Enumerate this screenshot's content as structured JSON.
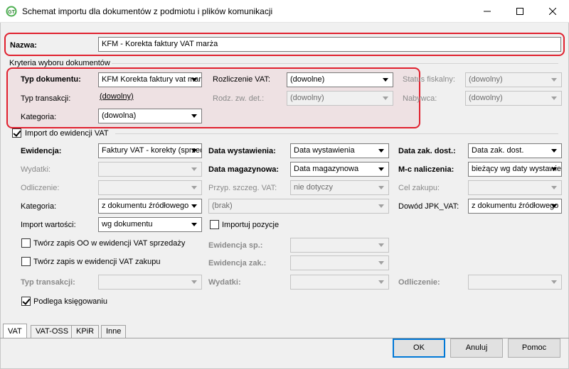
{
  "window": {
    "title": "Schemat importu dla dokumentów z podmiotu i plików komunikacji",
    "minimize_icon": "minimize-icon",
    "maximize_icon": "maximize-icon",
    "close_icon": "close-icon"
  },
  "nazwa": {
    "label": "Nazwa:",
    "value": "KFM - Korekta faktury VAT marża"
  },
  "kryteria": {
    "group_title": "Kryteria wyboru dokumentów",
    "typ_dokumentu": {
      "label": "Typ dokumentu:",
      "value": "KFM Korekta faktury vat marża"
    },
    "typ_transakcji": {
      "label": "Typ transakcji:",
      "value": "(dowolny)"
    },
    "kategoria": {
      "label": "Kategoria:",
      "value": "(dowolna)"
    },
    "rozliczenie_vat": {
      "label": "Rozliczenie VAT:",
      "value": "(dowolne)"
    },
    "rodz_zw_det": {
      "label": "Rodz. zw. det.:",
      "value": "(dowolny)"
    },
    "status_fiskalny": {
      "label": "Status fiskalny:",
      "value": "(dowolny)"
    },
    "nabywca": {
      "label": "Nabywca:",
      "value": "(dowolny)"
    }
  },
  "import_vat": {
    "checkbox_label": "Import do ewidencji VAT",
    "checked": true,
    "ewidencja": {
      "label": "Ewidencja:",
      "value": "Faktury VAT - korekty (sprzedaż)"
    },
    "wydatki": {
      "label": "Wydatki:",
      "value": ""
    },
    "odliczenie": {
      "label": "Odliczenie:",
      "value": ""
    },
    "kategoria": {
      "label": "Kategoria:",
      "value": "z dokumentu źródłowego"
    },
    "kategoria_opis": {
      "value": "(brak)"
    },
    "import_wartosci": {
      "label": "Import wartości:",
      "value": "wg dokumentu"
    },
    "importuj_pozycje": {
      "label": "Importuj pozycje",
      "checked": false
    },
    "data_wystawienia": {
      "label": "Data wystawienia:",
      "value": "Data wystawienia"
    },
    "data_magazynowa": {
      "label": "Data magazynowa:",
      "value": "Data magazynowa"
    },
    "przyp_szczeg_vat": {
      "label": "Przyp. szczeg. VAT:",
      "value": "nie dotyczy"
    },
    "data_zak_dost": {
      "label": "Data zak. dost.:",
      "value": "Data zak. dost."
    },
    "mc_naliczenia": {
      "label": "M-c naliczenia:",
      "value": "bieżący wg daty wystawienia"
    },
    "cel_zakupu": {
      "label": "Cel zakupu:",
      "value": ""
    },
    "dowod_jpk_vat": {
      "label": "Dowód JPK_VAT:",
      "value": "z dokumentu źródłowego"
    },
    "tworz_zapis_oo": {
      "label": "Twórz zapis OO w ewidencji VAT sprzedaży",
      "checked": false
    },
    "tworz_zapis_zak": {
      "label": "Twórz zapis w ewidencji VAT zakupu",
      "checked": false
    },
    "ewidencja_sp": {
      "label": "Ewidencja sp.:",
      "value": ""
    },
    "ewidencja_zak": {
      "label": "Ewidencja zak.:",
      "value": ""
    },
    "typ_transakcji": {
      "label": "Typ transakcji:",
      "value": ""
    },
    "wydatki2": {
      "label": "Wydatki:",
      "value": ""
    },
    "odliczenie2": {
      "label": "Odliczenie:",
      "value": ""
    },
    "podlega_ksiegowaniu": {
      "label": "Podlega księgowaniu",
      "checked": true
    }
  },
  "tabs": [
    "VAT",
    "VAT-OSS",
    "KPiR",
    "Inne"
  ],
  "buttons": {
    "ok": "OK",
    "anuluj": "Anuluj",
    "pomoc": "Pomoc"
  },
  "colors": {
    "highlight": "#e0202e",
    "accent": "#0078d7"
  }
}
